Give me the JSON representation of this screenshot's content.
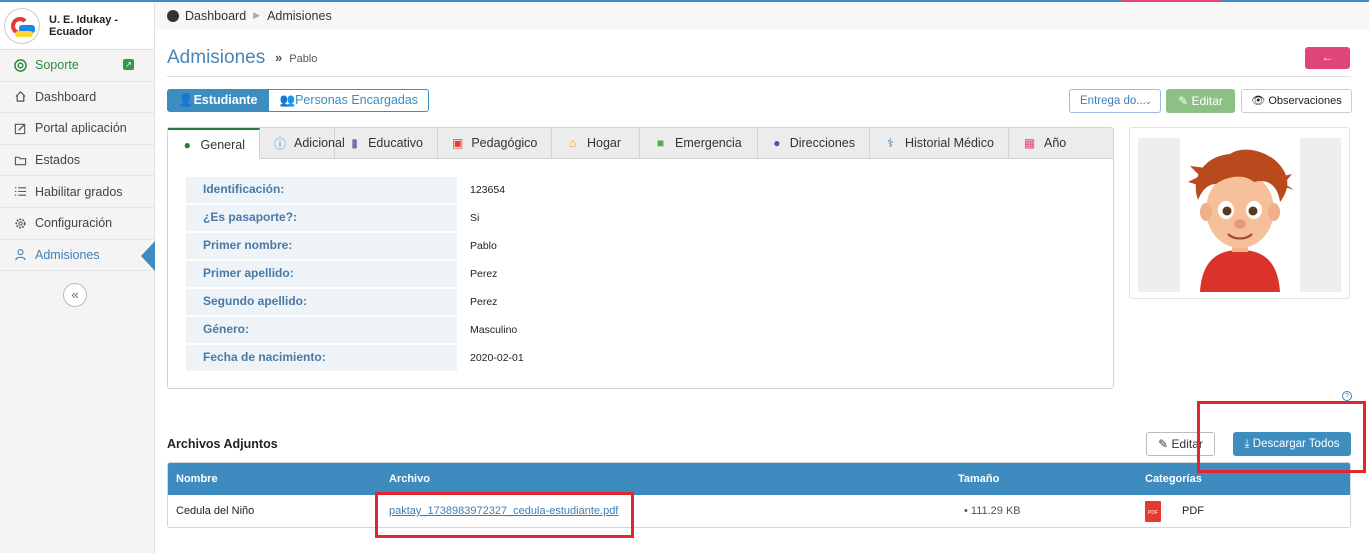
{
  "app": {
    "name": "U. E. Idukay - Ecuador"
  },
  "sidebar": {
    "items": [
      {
        "label": "Soporte",
        "icon": "lifebuoy-icon"
      },
      {
        "label": "Dashboard",
        "icon": "home-icon"
      },
      {
        "label": "Portal aplicación",
        "icon": "edit-icon"
      },
      {
        "label": "Estados",
        "icon": "folder-icon"
      },
      {
        "label": "Habilitar grados",
        "icon": "list-icon"
      },
      {
        "label": "Configuración",
        "icon": "gear-icon"
      },
      {
        "label": "Admisiones",
        "icon": "user-icon"
      }
    ],
    "collapse": "«"
  },
  "breadcrumb": {
    "home": "Dashboard",
    "current": "Admisiones"
  },
  "page": {
    "title": "Admisiones",
    "subtitle_sep": "»",
    "subtitle": "Pablo",
    "back": "←"
  },
  "segmented": {
    "student": "Estudiante",
    "guardians": "Personas Encargadas"
  },
  "actions": {
    "entrega": "Entrega do...",
    "editar": "Editar",
    "observaciones": "Observaciones"
  },
  "tabs": [
    "General",
    "Adicional",
    "Educativo",
    "Pedagógico",
    "Hogar",
    "Emergencia",
    "Direcciones",
    "Historial Médico",
    "Año"
  ],
  "general": [
    {
      "key": "Identificación:",
      "value": "123654"
    },
    {
      "key": "¿Es pasaporte?:",
      "value": "Si"
    },
    {
      "key": "Primer nombre:",
      "value": "Pablo"
    },
    {
      "key": "Primer apellido:",
      "value": "Perez"
    },
    {
      "key": "Segundo apellido:",
      "value": "Perez"
    },
    {
      "key": "Género:",
      "value": "Masculino"
    },
    {
      "key": "Fecha de nacimiento:",
      "value": "2020-02-01"
    }
  ],
  "help": "?",
  "attachments": {
    "title": "Archivos Adjuntos",
    "edit": "Editar",
    "download_all": "Descargar Todos",
    "columns": [
      "Nombre",
      "Archivo",
      "Tamaño",
      "Categorías"
    ],
    "rows": [
      {
        "name": "Cedula del Niño",
        "file": "paktay_1738983972327_cedula-estudiante.pdf",
        "size": "• 111.29 KB",
        "category": "PDF"
      }
    ]
  },
  "colors": {
    "accent": "#3d8dbf",
    "highlight": "#e3252d",
    "danger": "#e0447a",
    "success": "#8cc084"
  }
}
